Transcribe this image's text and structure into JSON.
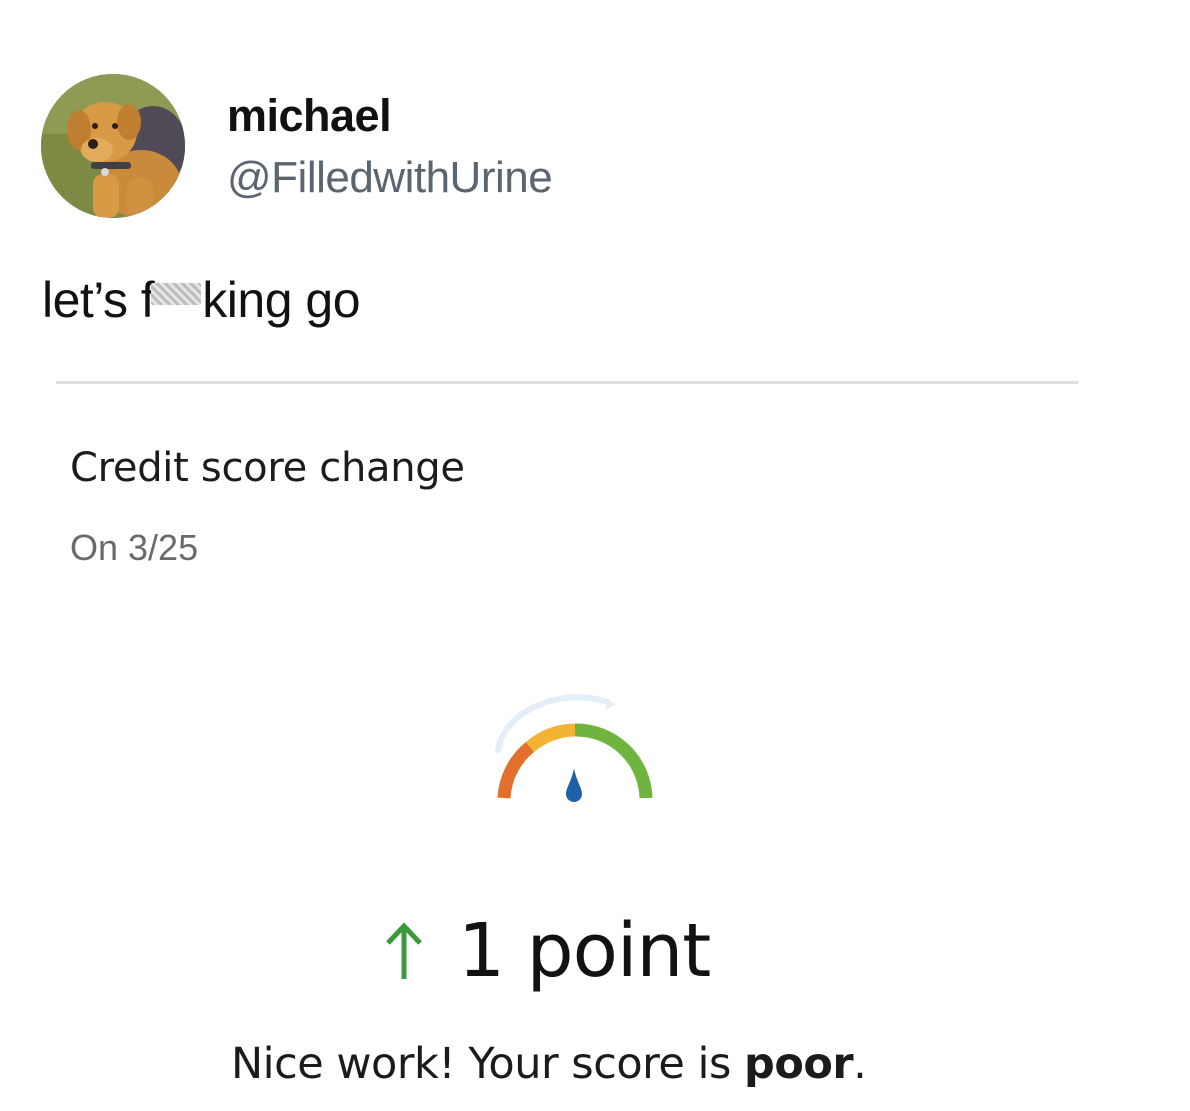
{
  "tweet": {
    "author": {
      "display_name": "michael",
      "handle": "@FilledwithUrine",
      "avatar_icon": "stuffed-dog-avatar"
    },
    "text_before_censor": "let’s f",
    "text_after_censor": "king go"
  },
  "card": {
    "title": "Credit score change",
    "date": "On 3/25",
    "gauge_icon": "credit-gauge-icon",
    "change_icon": "arrow-up-icon",
    "change_value": "1 point",
    "message_prefix": "Nice work! Your score is ",
    "message_emphasis": "poor",
    "message_suffix": ".",
    "colors": {
      "gauge_low": "#e36f2c",
      "gauge_mid": "#f2b233",
      "gauge_high": "#6fb43f",
      "needle": "#1f5fa8",
      "arrow": "#3a9a3a"
    }
  }
}
